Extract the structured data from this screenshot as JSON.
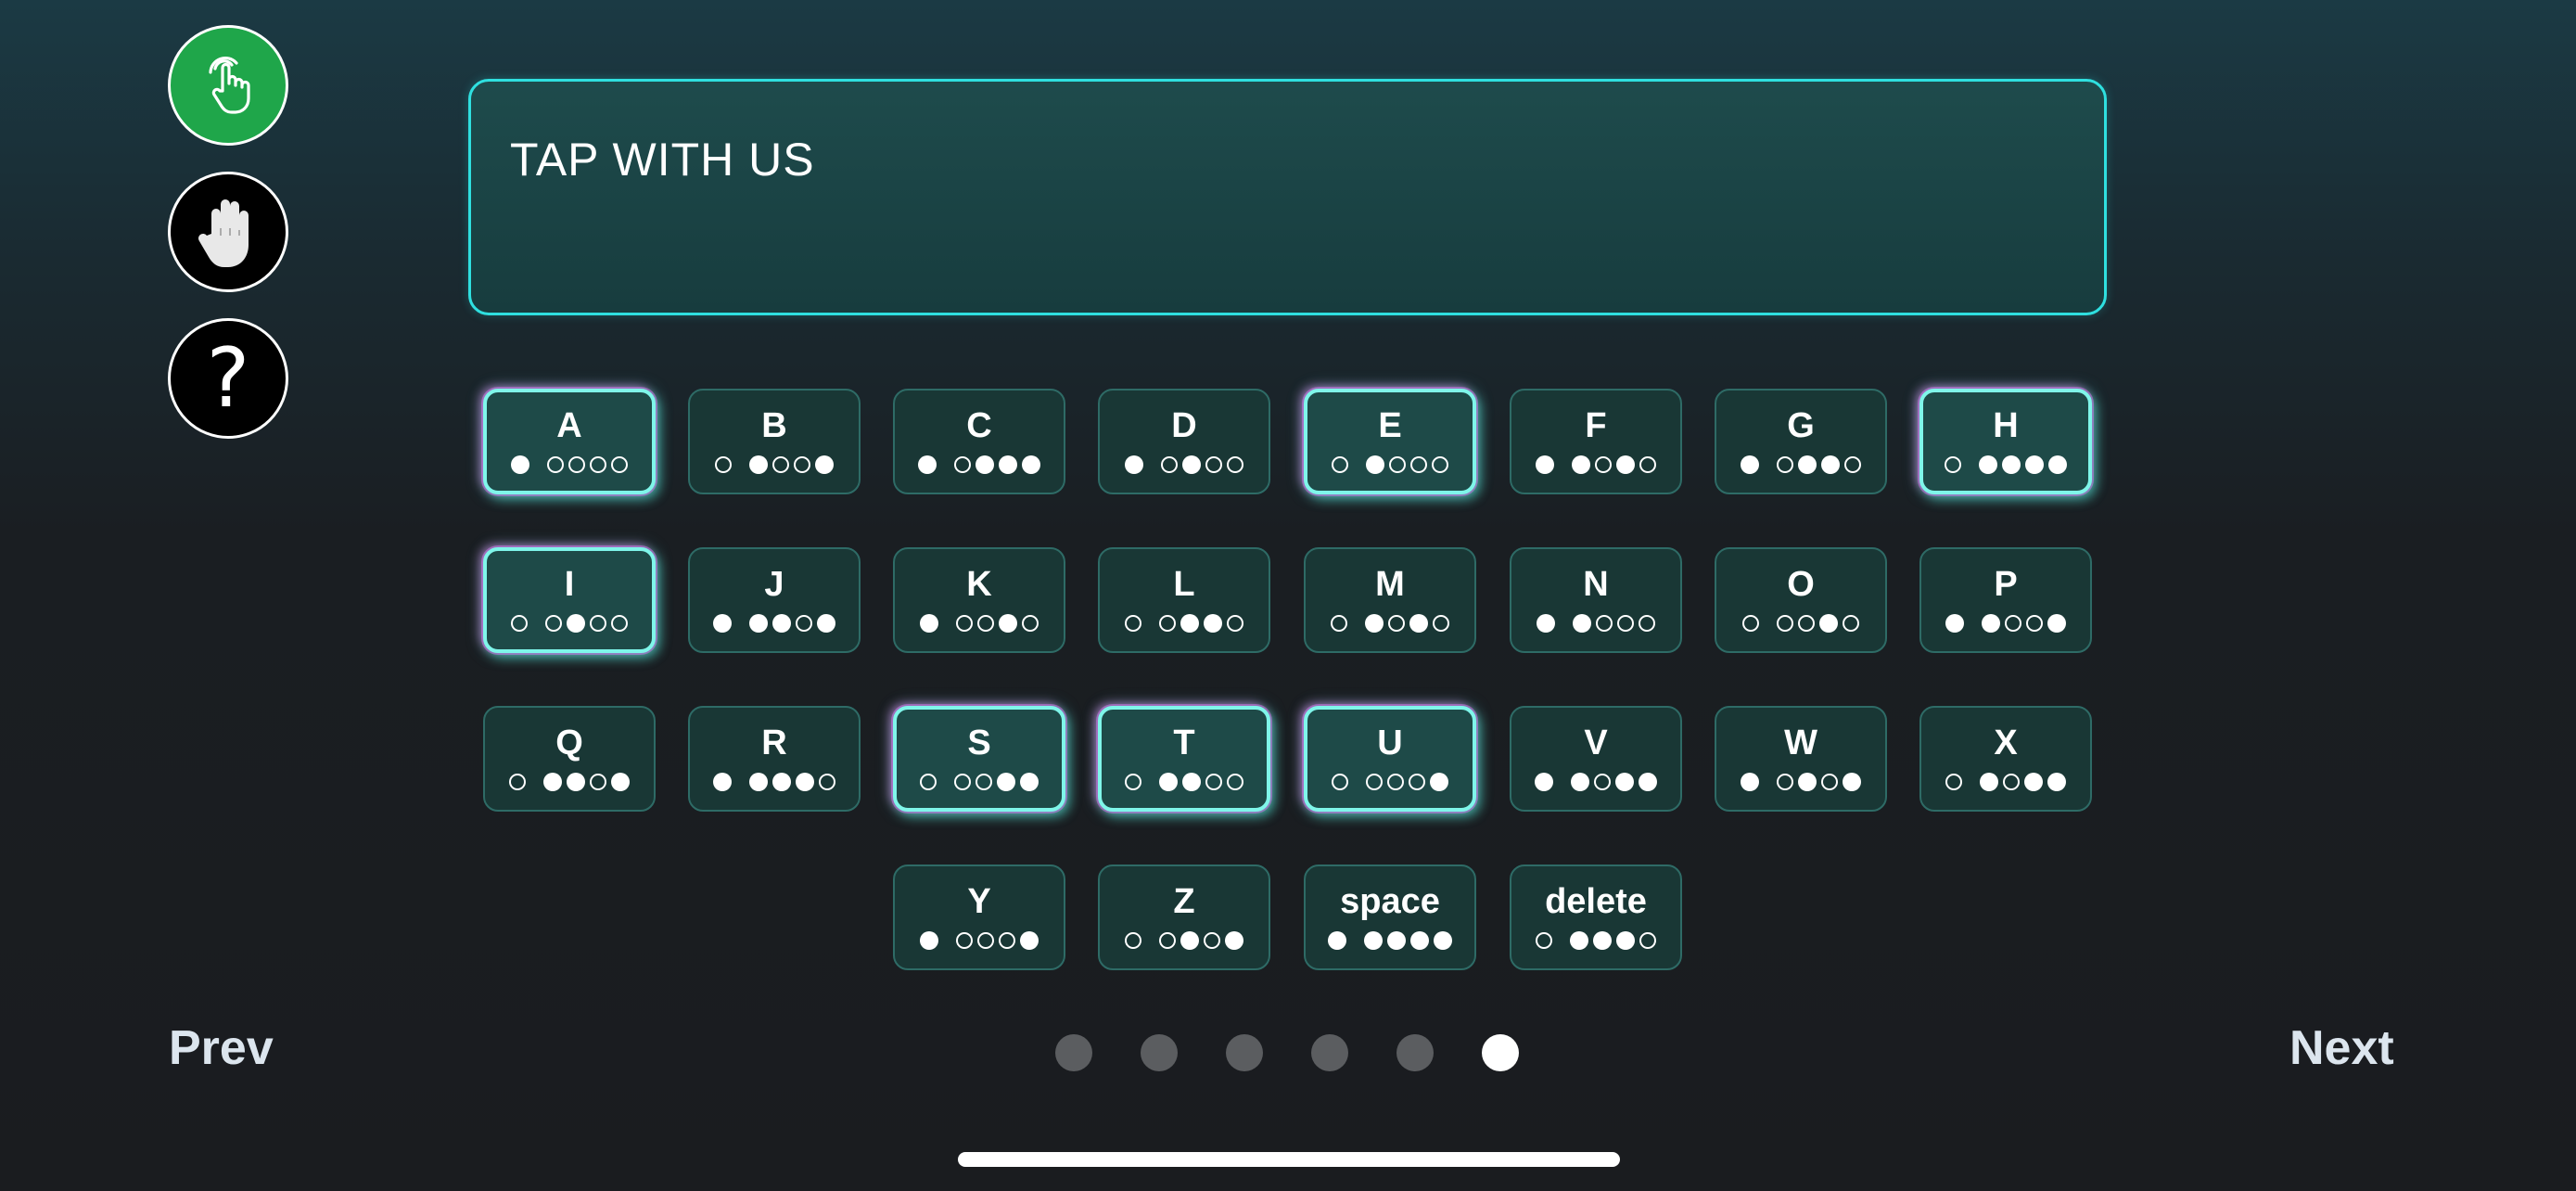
{
  "sidebar": {
    "buttons": [
      {
        "name": "tap-mode",
        "icon": "pointing-hand-icon",
        "color": "#1fa64a"
      },
      {
        "name": "stop",
        "icon": "raised-hand-icon",
        "color": "#000000"
      },
      {
        "name": "help",
        "icon": "question-icon",
        "symbol": "?",
        "color": "#000000"
      }
    ]
  },
  "display": {
    "text": "TAP WITH US"
  },
  "keys": [
    {
      "label": "A",
      "pattern": "1-0000",
      "highlighted": true
    },
    {
      "label": "B",
      "pattern": "0-1001",
      "highlighted": false
    },
    {
      "label": "C",
      "pattern": "1-0111",
      "highlighted": false
    },
    {
      "label": "D",
      "pattern": "1-0100",
      "highlighted": false
    },
    {
      "label": "E",
      "pattern": "0-1000",
      "highlighted": true
    },
    {
      "label": "F",
      "pattern": "1-1010",
      "highlighted": false
    },
    {
      "label": "G",
      "pattern": "1-0110",
      "highlighted": false
    },
    {
      "label": "H",
      "pattern": "0-1111",
      "highlighted": true
    },
    {
      "label": "I",
      "pattern": "0-0100",
      "highlighted": true
    },
    {
      "label": "J",
      "pattern": "1-1101",
      "highlighted": false
    },
    {
      "label": "K",
      "pattern": "1-0010",
      "highlighted": false
    },
    {
      "label": "L",
      "pattern": "0-0110",
      "highlighted": false
    },
    {
      "label": "M",
      "pattern": "0-1010",
      "highlighted": false
    },
    {
      "label": "N",
      "pattern": "1-1000",
      "highlighted": false
    },
    {
      "label": "O",
      "pattern": "0-0010",
      "highlighted": false
    },
    {
      "label": "P",
      "pattern": "1-1001",
      "highlighted": false
    },
    {
      "label": "Q",
      "pattern": "0-1101",
      "highlighted": false
    },
    {
      "label": "R",
      "pattern": "1-1110",
      "highlighted": false
    },
    {
      "label": "S",
      "pattern": "0-0011",
      "highlighted": true
    },
    {
      "label": "T",
      "pattern": "0-1100",
      "highlighted": true
    },
    {
      "label": "U",
      "pattern": "0-0001",
      "highlighted": true
    },
    {
      "label": "V",
      "pattern": "1-1011",
      "highlighted": false
    },
    {
      "label": "W",
      "pattern": "1-0101",
      "highlighted": false
    },
    {
      "label": "X",
      "pattern": "0-1011",
      "highlighted": false
    },
    {
      "label": "Y",
      "pattern": "1-0001",
      "highlighted": false
    },
    {
      "label": "Z",
      "pattern": "0-0101",
      "highlighted": false
    },
    {
      "label": "space",
      "pattern": "1-1111",
      "highlighted": false
    },
    {
      "label": "delete",
      "pattern": "0-1110",
      "highlighted": false
    }
  ],
  "nav": {
    "prev_label": "Prev",
    "next_label": "Next",
    "page_count": 6,
    "current_page": 6
  },
  "colors": {
    "accent": "#2fe0e0",
    "tap_button": "#1fa64a"
  }
}
